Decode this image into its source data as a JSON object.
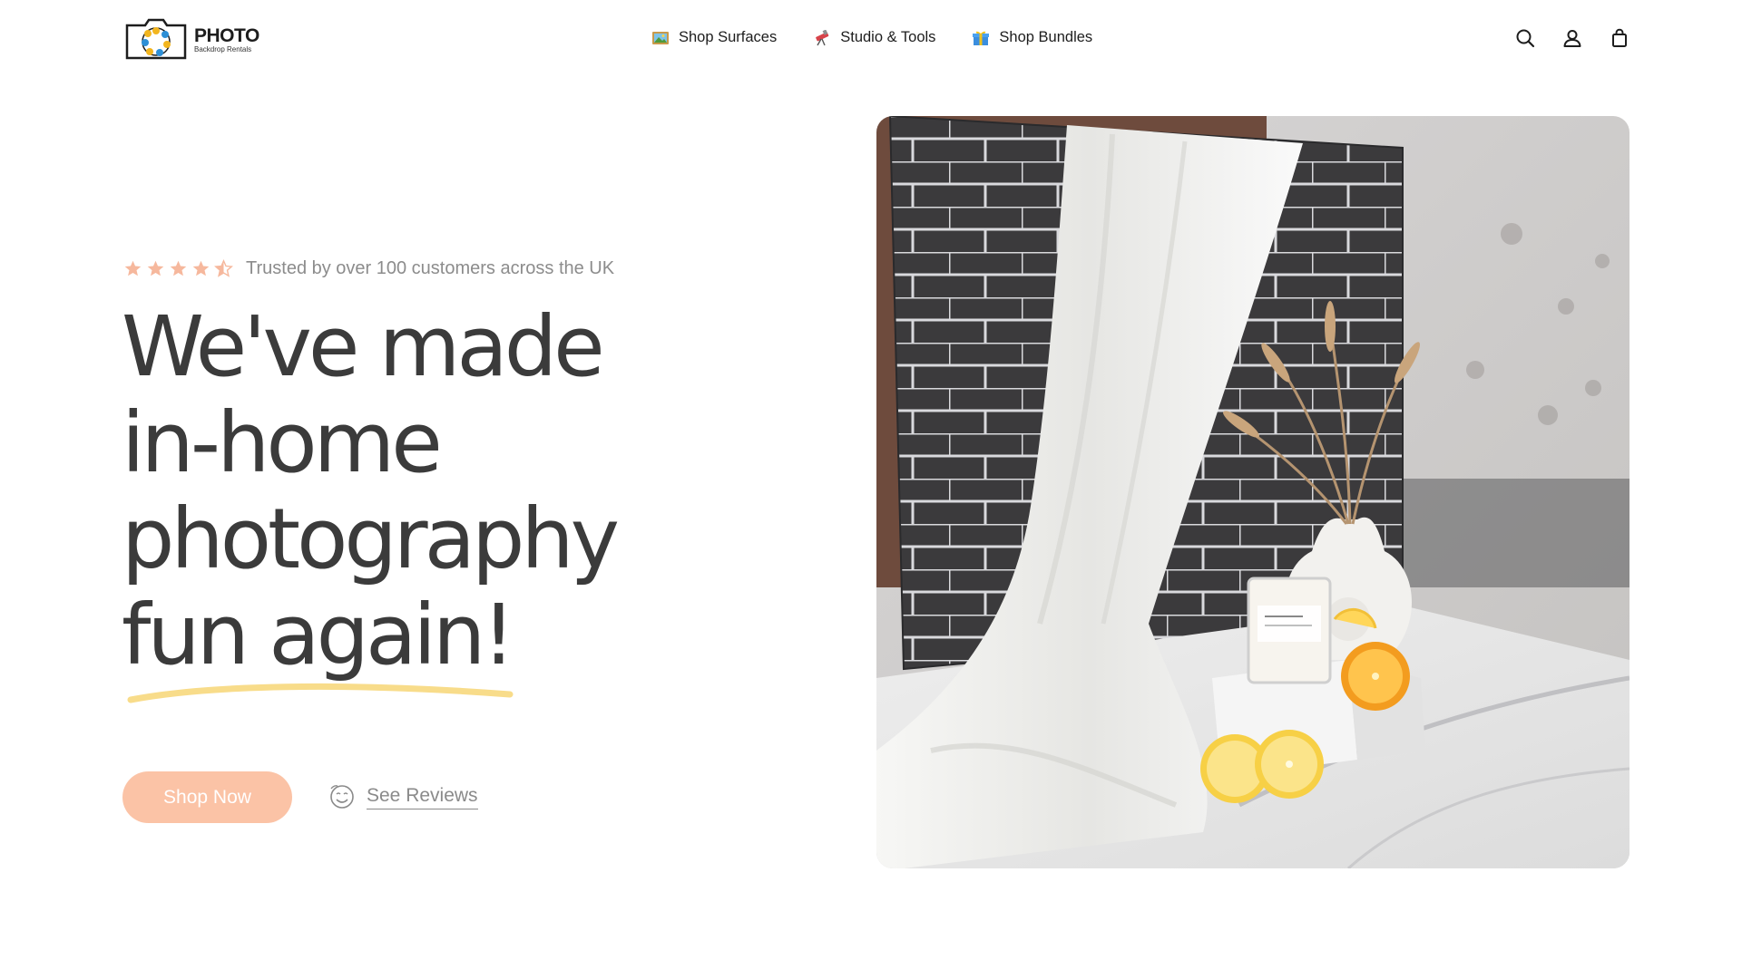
{
  "brand": {
    "title": "PHOTO",
    "subtitle": "Backdrop Rentals"
  },
  "nav": {
    "items": [
      {
        "label": "Shop Surfaces",
        "icon": "framed-picture-icon"
      },
      {
        "label": "Studio & Tools",
        "icon": "telescope-icon"
      },
      {
        "label": "Shop Bundles",
        "icon": "gift-icon"
      }
    ]
  },
  "header_icons": [
    "search-icon",
    "account-icon",
    "shopping-bag-icon"
  ],
  "hero": {
    "rating": 4.5,
    "rating_max": 5,
    "rating_text": "Trusted by over 100 customers across the UK",
    "headline_lines": [
      "We've made",
      "in-home",
      "photography",
      "fun again!"
    ],
    "cta_label": "Shop Now",
    "reviews_label": "See Reviews",
    "reviews_icon": "smiling-face-icon"
  },
  "colors": {
    "accent": "#fbc3a6",
    "star": "#f6b89d",
    "underline": "#f8dc8a",
    "heading": "#3b3b3b",
    "muted": "#8c8c8c"
  }
}
